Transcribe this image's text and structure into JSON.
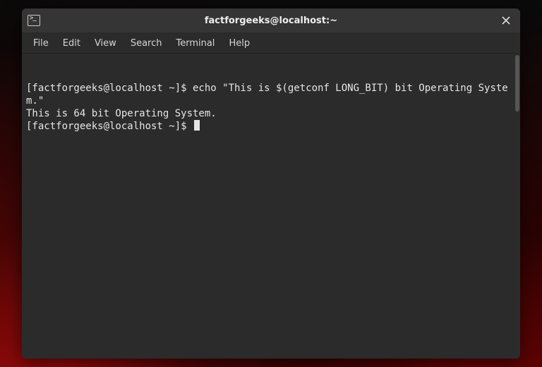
{
  "window": {
    "title": "factforgeeks@localhost:~"
  },
  "menubar": {
    "items": [
      "File",
      "Edit",
      "View",
      "Search",
      "Terminal",
      "Help"
    ]
  },
  "terminal": {
    "prompt": "[factforgeeks@localhost ~]$ ",
    "lines": [
      {
        "prompt": true,
        "text": "echo \"This is $(getconf LONG_BIT) bit Operating System.\""
      },
      {
        "prompt": false,
        "text": "This is 64 bit Operating System."
      },
      {
        "prompt": true,
        "text": "",
        "cursor": true
      }
    ]
  }
}
